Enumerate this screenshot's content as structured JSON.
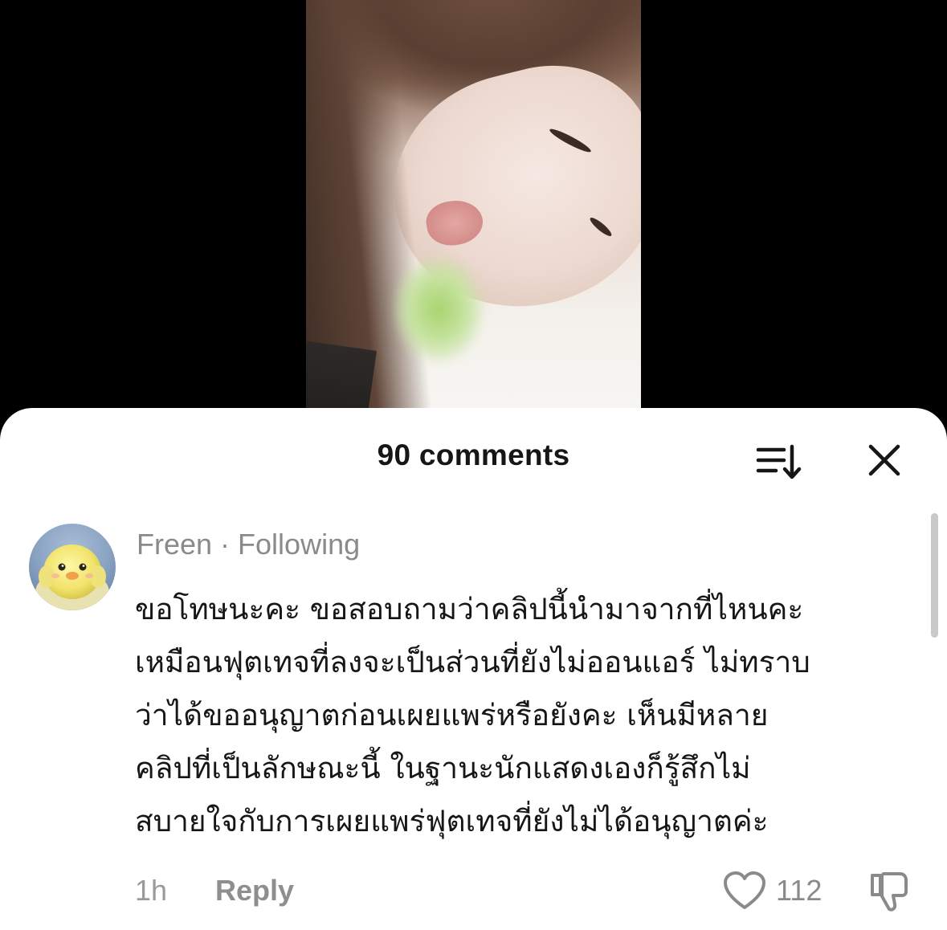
{
  "video": {
    "icon": "video-frame"
  },
  "comments_panel": {
    "title": "90 comments",
    "sort_icon": "sort-icon",
    "close_icon": "close-icon"
  },
  "comment": {
    "username": "Freen",
    "separator": "·",
    "follow_status": "Following",
    "avatar_icon": "chick-avatar",
    "lines": [
      "ขอโทษนะคะ ขอสอบถามว่าคลิปนี้นำมาจากที่ไหนคะ",
      "เหมือนฟุตเทจที่ลงจะเป็นส่วนที่ยังไม่ออนแอร์ ไม่ทราบ",
      "ว่าได้ขออนุญาตก่อนเผยแพร่หรือยังคะ เห็นมีหลาย",
      "คลิปที่เป็นลักษณะนี้  ในฐานะนักแสดงเองก็รู้สึกไม่",
      "สบายใจกับการเผยแพร่ฟุตเทจที่ยังไม่ได้อนุญาตค่ะ"
    ],
    "time": "1h",
    "reply_label": "Reply",
    "like_icon": "heart-icon",
    "like_count": "112",
    "dislike_icon": "thumbs-down-icon"
  }
}
